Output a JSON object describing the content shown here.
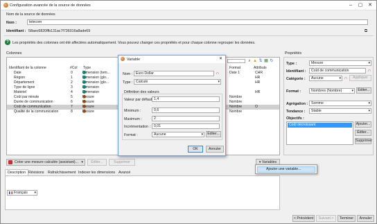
{
  "window": {
    "title": "Configuration avancée de la source de données"
  },
  "source": {
    "name_heading": "Nom de la source de données",
    "name_label": "Nom :",
    "name_value": "telecom",
    "id_label": "Identifiant :",
    "id_value": "58aec6820ffb131ac7f736016a8ade69"
  },
  "info_text": "Les propriétés des colonnes ont été affectées automatiquement. Vous pouvez changer ces propriétés et pour chaque colonne regrouper les données.",
  "columns": {
    "section_label": "Colonnes",
    "headers": [
      "Identifiant de la colonne",
      "#Col",
      "Type",
      "Format",
      "Attributs"
    ],
    "rows": [
      {
        "name": "Date",
        "col": "0",
        "type": "Dimension (tem...",
        "kind": "dim",
        "format": "Date 1",
        "attr": "CHR"
      },
      {
        "name": "Région",
        "col": "1",
        "type": "Dimension (glo...",
        "kind": "dim",
        "format": "",
        "attr": "HR"
      },
      {
        "name": "Département",
        "col": "2",
        "type": "Dimension (glo...",
        "kind": "dim",
        "format": "",
        "attr": "HR"
      },
      {
        "name": "Type de ligne",
        "col": "3",
        "type": "Dimension",
        "kind": "dim",
        "format": "",
        "attr": ""
      },
      {
        "name": "Matériel",
        "col": "4",
        "type": "Dimension",
        "kind": "dim",
        "format": "",
        "attr": "HR"
      },
      {
        "name": "Coût par minute",
        "col": "5",
        "type": "Mesure",
        "kind": "mes",
        "format": "Nombre",
        "attr": ""
      },
      {
        "name": "Durée de communication",
        "col": "6",
        "type": "Mesure",
        "kind": "mes",
        "format": "Nombre",
        "attr": ""
      },
      {
        "name": "Coût de communication",
        "col": "7",
        "type": "Mesure",
        "kind": "mes",
        "format": "Nombre",
        "attr": "O"
      },
      {
        "name": "Qualité de la communication",
        "col": "8",
        "type": "Mesure",
        "kind": "mes",
        "format": "Nombre",
        "attr": ""
      }
    ],
    "create_measure_btn": "Créer une mesure calculée (assistant)...",
    "edit_btn": "Éditer...",
    "delete_btn": "Supprimer",
    "variables_btn": "Variables"
  },
  "context_menu": {
    "item": "Ajouter une variable..."
  },
  "bottom_tabs": [
    "Description",
    "Révisions",
    "Rafraîchissement",
    "Indexer les dimensions",
    "Avancé"
  ],
  "language": "Français",
  "footer": {
    "prev": "< Précédent",
    "next": "Suivant >",
    "finish": "Terminer",
    "cancel": "Annuler"
  },
  "properties": {
    "title": "Propriétés",
    "type_label": "Type :",
    "type_value": "Mesure",
    "id_label": "Identifiant :",
    "id_value": "Coût de communication",
    "category_label": "Catégorie :",
    "category_value": "Aucune",
    "apply_btn": "Appliquer",
    "format_label": "Format :",
    "format_value": "Nombres (Nombre)",
    "edit_btn": "Éditer...",
    "aggregation_label": "Agrégation :",
    "aggregation_value": "Somme",
    "trend_label": "Tendance :",
    "trend_value": "Stable",
    "objectives_label": "Objectifs :",
    "objective_item": "Coût décroissant",
    "add_btn": "Ajouter...",
    "edit2_btn": "Éditer...",
    "delete_btn": "Supprimer"
  },
  "dialog": {
    "title": "Variable",
    "name_label": "Nom :",
    "name_value": "Euro Dollar",
    "type_label": "Type :",
    "type_value": "Calculé",
    "group_label": "Définition des valeurs",
    "default_label": "Valeur par défaut :",
    "default_value": "1,4",
    "min_label": "Minimum :",
    "min_value": "0,6",
    "max_label": "Maximum :",
    "max_value": "2",
    "inc_label": "Incrémentation :",
    "inc_value": "0,01",
    "format_label": "Format :",
    "format_value": "Aucune",
    "edit_btn": "Éditer...",
    "ok_btn": "OK",
    "cancel_btn": "Annuler"
  },
  "colors": {
    "dimension": "#16a08a",
    "measure": "#c8702e",
    "selection": "#cfcfcf",
    "highlight": "#cce4f7"
  }
}
